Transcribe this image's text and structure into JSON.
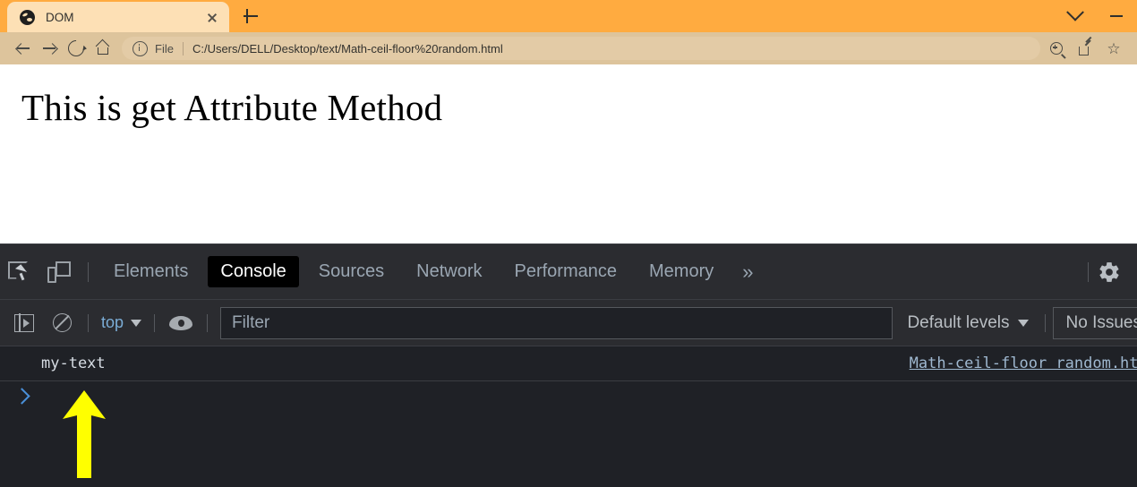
{
  "browser": {
    "tab": {
      "title": "DOM",
      "favicon": "globe-icon",
      "close_label": "×"
    },
    "new_tab_label": "+",
    "window_controls": {
      "chevron_label": "⌄",
      "minimize_label": "—"
    },
    "toolbar": {
      "back_label": "←",
      "forward_label": "→",
      "reload_label": "⟳",
      "home_label": "⌂",
      "omnibox": {
        "security_icon": "info-circle-icon",
        "scheme_label": "File",
        "url": "C:/Users/DELL/Desktop/text/Math-ceil-floor%20random.html"
      },
      "zoom_label": "zoom-in-icon",
      "share_label": "share-icon",
      "bookmark_label": "☆"
    },
    "colors": {
      "titlebar": "#ffab40",
      "tab_active": "#fde0b5",
      "toolbar": "#ddc49c",
      "omnibox": "#e3cba6"
    }
  },
  "page": {
    "heading": "This is get Attribute Method"
  },
  "devtools": {
    "tools": {
      "inspect_label": "inspect-element-icon",
      "device_label": "device-toolbar-icon"
    },
    "tabs": [
      {
        "label": "Elements",
        "active": false
      },
      {
        "label": "Console",
        "active": true
      },
      {
        "label": "Sources",
        "active": false
      },
      {
        "label": "Network",
        "active": false
      },
      {
        "label": "Performance",
        "active": false
      },
      {
        "label": "Memory",
        "active": false
      }
    ],
    "more_tabs_label": "»",
    "settings_label": "gear-icon",
    "console_toolbar": {
      "sidebar_toggle_label": "console-sidebar-icon",
      "clear_label": "clear-console-icon",
      "context": {
        "value": "top",
        "caret": "▼"
      },
      "eye_label": "live-expression-icon",
      "filter": {
        "placeholder": "Filter",
        "value": ""
      },
      "levels": {
        "value": "Default levels",
        "caret": "▼"
      },
      "issues": {
        "label": "No Issues"
      }
    },
    "console_messages": [
      {
        "text": "my-text",
        "source": "Math-ceil-floor random.html"
      }
    ],
    "prompt": {
      "chevron": ">",
      "value": ""
    },
    "annotation": {
      "type": "arrow-up",
      "color": "#ffff00",
      "points_to": "my-text"
    },
    "colors": {
      "panel_bg": "#2b2c30",
      "console_bg": "#1f2126",
      "active_tab_bg": "#000000",
      "link": "#9fb8d0",
      "prompt": "#4a90d9"
    }
  }
}
